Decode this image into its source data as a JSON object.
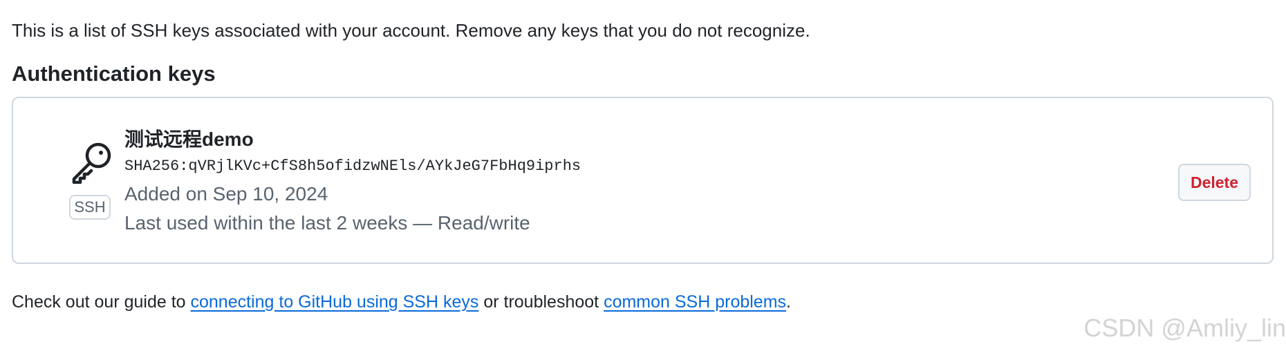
{
  "intro_text": "This is a list of SSH keys associated with your account. Remove any keys that you do not recognize.",
  "section_heading": "Authentication keys",
  "keys": [
    {
      "title": "测试远程demo",
      "fingerprint": "SHA256:qVRjlKVc+CfS8h5ofidzwNEls/AYkJeG7FbHq9iprhs",
      "added": "Added on Sep 10, 2024",
      "last_used": "Last used within the last 2 weeks — Read/write",
      "type_label": "SSH",
      "icon": "key-icon",
      "delete_label": "Delete"
    }
  ],
  "footer": {
    "prefix": "Check out our guide to ",
    "link1": "connecting to GitHub using SSH keys",
    "middle": " or troubleshoot ",
    "link2": "common SSH problems",
    "suffix": "."
  },
  "watermark": "CSDN @Amliy_lin",
  "colors": {
    "danger": "#cf222e",
    "link": "#0969da",
    "muted": "#59636e",
    "border": "#d0d7de"
  }
}
